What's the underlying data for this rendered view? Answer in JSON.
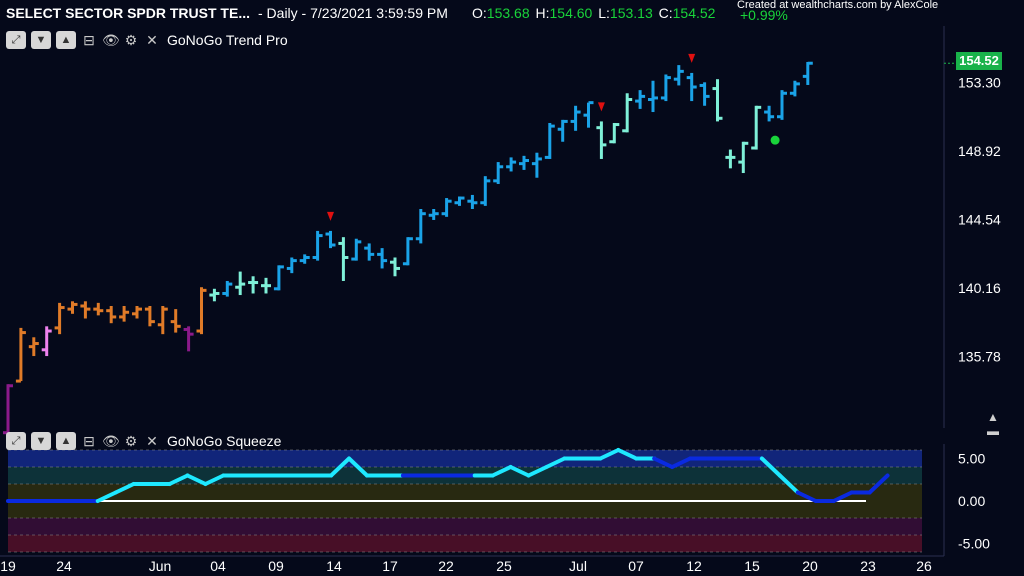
{
  "header": {
    "symbol": "SELECT SECTOR SPDR TRUST TE...",
    "meta": "- Daily - 7/23/2021 3:59:59 PM",
    "ohlc": [
      {
        "k": "O:",
        "v": "153.68"
      },
      {
        "k": "H:",
        "v": "154.60"
      },
      {
        "k": "L:",
        "v": "153.13"
      },
      {
        "k": "C:",
        "v": "154.52"
      }
    ],
    "change": "+0.99%",
    "credit": "Created at wealthcharts.com by AlexCole"
  },
  "top_panel": {
    "title": "GoNoGo Trend Pro",
    "last_price": "154.52"
  },
  "bottom_panel": {
    "title": "GoNoGo Squeeze"
  },
  "icons": [
    "expand-icon",
    "chevron-down-icon",
    "chevron-up-icon",
    "collapse-icon",
    "eye-icon",
    "gear-icon",
    "close-icon"
  ],
  "colors": {
    "background": "#05091a",
    "go_strong": "#1aa3e8",
    "go_weak": "#7ff0d8",
    "nogo_strong": "#8b1a8a",
    "nogo_weak": "#e07b28",
    "amber": "#e07b28",
    "pink": "#ee82ee",
    "marker_red": "#e01010",
    "marker_green": "#19d43a",
    "squeeze_cyan": "#1ee8ff",
    "squeeze_blue": "#0a2ae0",
    "positive": "#19d43a"
  },
  "chart_data": [
    {
      "type": "ohlc",
      "name": "GoNoGo Trend Pro",
      "x_tick_labels": [
        "19",
        "24",
        "Jun",
        "04",
        "09",
        "14",
        "17",
        "22",
        "25",
        "Jul",
        "07",
        "12",
        "15",
        "20",
        "23",
        "26"
      ],
      "y_tick_labels": [
        "153.30",
        "148.92",
        "144.54",
        "140.16",
        "135.78"
      ],
      "ylim": [
        131.2,
        156.9
      ],
      "color_key": {
        "G": "go_strong",
        "g": "go_weak",
        "a": "amber",
        "p": "pink",
        "m": "nogo_strong"
      },
      "bars": [
        {
          "o": 130.9,
          "h": 134.0,
          "l": 130.4,
          "c": 133.9,
          "color": "m"
        },
        {
          "o": 134.2,
          "h": 137.6,
          "l": 134.2,
          "c": 137.3,
          "color": "a"
        },
        {
          "o": 136.4,
          "h": 137.0,
          "l": 135.8,
          "c": 136.6,
          "color": "a"
        },
        {
          "o": 136.2,
          "h": 137.7,
          "l": 135.8,
          "c": 137.4,
          "color": "p"
        },
        {
          "o": 137.6,
          "h": 139.2,
          "l": 137.2,
          "c": 138.9,
          "color": "a"
        },
        {
          "o": 138.8,
          "h": 139.3,
          "l": 138.5,
          "c": 139.1,
          "color": "a"
        },
        {
          "o": 139.0,
          "h": 139.3,
          "l": 138.2,
          "c": 138.8,
          "color": "a"
        },
        {
          "o": 138.8,
          "h": 139.2,
          "l": 138.4,
          "c": 138.7,
          "color": "a"
        },
        {
          "o": 138.7,
          "h": 139.0,
          "l": 137.9,
          "c": 138.3,
          "color": "a"
        },
        {
          "o": 138.3,
          "h": 139.0,
          "l": 138.0,
          "c": 138.6,
          "color": "a"
        },
        {
          "o": 138.5,
          "h": 139.0,
          "l": 138.2,
          "c": 138.8,
          "color": "a"
        },
        {
          "o": 138.8,
          "h": 139.0,
          "l": 137.7,
          "c": 138.0,
          "color": "a"
        },
        {
          "o": 137.8,
          "h": 139.0,
          "l": 137.2,
          "c": 138.8,
          "color": "a"
        },
        {
          "o": 138.0,
          "h": 138.8,
          "l": 137.3,
          "c": 137.7,
          "color": "a"
        },
        {
          "o": 137.5,
          "h": 137.7,
          "l": 136.1,
          "c": 137.2,
          "color": "m"
        },
        {
          "o": 137.4,
          "h": 140.2,
          "l": 137.2,
          "c": 140.0,
          "color": "a"
        },
        {
          "o": 139.7,
          "h": 140.1,
          "l": 139.3,
          "c": 139.8,
          "color": "g"
        },
        {
          "o": 139.8,
          "h": 140.6,
          "l": 139.6,
          "c": 140.4,
          "color": "G"
        },
        {
          "o": 140.2,
          "h": 141.2,
          "l": 139.7,
          "c": 140.4,
          "color": "g"
        },
        {
          "o": 140.5,
          "h": 140.9,
          "l": 139.8,
          "c": 140.5,
          "color": "g"
        },
        {
          "o": 140.3,
          "h": 140.8,
          "l": 139.8,
          "c": 140.3,
          "color": "g"
        },
        {
          "o": 140.1,
          "h": 141.6,
          "l": 140.0,
          "c": 141.5,
          "color": "G"
        },
        {
          "o": 141.4,
          "h": 142.1,
          "l": 141.1,
          "c": 141.9,
          "color": "G"
        },
        {
          "o": 141.9,
          "h": 142.3,
          "l": 141.7,
          "c": 142.1,
          "color": "G"
        },
        {
          "o": 142.1,
          "h": 143.8,
          "l": 141.9,
          "c": 143.5,
          "color": "G"
        },
        {
          "o": 143.6,
          "h": 143.8,
          "l": 142.7,
          "c": 142.9,
          "color": "G"
        },
        {
          "o": 143.0,
          "h": 143.4,
          "l": 140.6,
          "c": 142.1,
          "color": "g"
        },
        {
          "o": 142.0,
          "h": 143.3,
          "l": 141.9,
          "c": 143.1,
          "color": "G"
        },
        {
          "o": 142.7,
          "h": 143.0,
          "l": 141.9,
          "c": 142.3,
          "color": "G"
        },
        {
          "o": 142.3,
          "h": 142.7,
          "l": 141.4,
          "c": 141.9,
          "color": "G"
        },
        {
          "o": 141.8,
          "h": 142.1,
          "l": 140.9,
          "c": 141.4,
          "color": "g"
        },
        {
          "o": 141.7,
          "h": 143.4,
          "l": 141.6,
          "c": 143.3,
          "color": "G"
        },
        {
          "o": 143.3,
          "h": 145.2,
          "l": 143.0,
          "c": 144.9,
          "color": "G"
        },
        {
          "o": 144.8,
          "h": 145.2,
          "l": 144.5,
          "c": 144.9,
          "color": "G"
        },
        {
          "o": 144.9,
          "h": 145.9,
          "l": 144.7,
          "c": 145.7,
          "color": "G"
        },
        {
          "o": 145.6,
          "h": 146.0,
          "l": 145.4,
          "c": 145.9,
          "color": "G"
        },
        {
          "o": 145.7,
          "h": 146.1,
          "l": 145.2,
          "c": 145.6,
          "color": "G"
        },
        {
          "o": 145.6,
          "h": 147.3,
          "l": 145.4,
          "c": 147.0,
          "color": "G"
        },
        {
          "o": 147.0,
          "h": 148.2,
          "l": 146.8,
          "c": 147.9,
          "color": "G"
        },
        {
          "o": 147.9,
          "h": 148.5,
          "l": 147.6,
          "c": 148.2,
          "color": "G"
        },
        {
          "o": 148.1,
          "h": 148.6,
          "l": 147.7,
          "c": 148.3,
          "color": "G"
        },
        {
          "o": 148.1,
          "h": 148.8,
          "l": 147.2,
          "c": 148.4,
          "color": "G"
        },
        {
          "o": 148.5,
          "h": 150.7,
          "l": 148.4,
          "c": 150.5,
          "color": "G"
        },
        {
          "o": 150.3,
          "h": 150.9,
          "l": 149.5,
          "c": 150.8,
          "color": "G"
        },
        {
          "o": 150.8,
          "h": 151.8,
          "l": 150.2,
          "c": 151.4,
          "color": "G"
        },
        {
          "o": 151.2,
          "h": 152.0,
          "l": 150.4,
          "c": 152.0,
          "color": "G"
        },
        {
          "o": 150.4,
          "h": 150.8,
          "l": 148.4,
          "c": 149.3,
          "color": "g"
        },
        {
          "o": 149.5,
          "h": 150.7,
          "l": 149.4,
          "c": 150.6,
          "color": "g"
        },
        {
          "o": 150.2,
          "h": 152.6,
          "l": 150.1,
          "c": 152.2,
          "color": "g"
        },
        {
          "o": 152.1,
          "h": 152.8,
          "l": 151.6,
          "c": 152.4,
          "color": "G"
        },
        {
          "o": 152.2,
          "h": 153.4,
          "l": 151.4,
          "c": 152.3,
          "color": "G"
        },
        {
          "o": 152.3,
          "h": 153.8,
          "l": 152.1,
          "c": 153.6,
          "color": "G"
        },
        {
          "o": 153.5,
          "h": 154.4,
          "l": 153.1,
          "c": 154.0,
          "color": "G"
        },
        {
          "o": 153.6,
          "h": 153.9,
          "l": 152.1,
          "c": 153.0,
          "color": "G"
        },
        {
          "o": 153.1,
          "h": 153.3,
          "l": 151.8,
          "c": 152.4,
          "color": "G"
        },
        {
          "o": 152.9,
          "h": 153.5,
          "l": 150.8,
          "c": 151.0,
          "color": "g"
        },
        {
          "o": 148.5,
          "h": 149.0,
          "l": 147.8,
          "c": 148.5,
          "color": "g"
        },
        {
          "o": 148.2,
          "h": 149.5,
          "l": 147.5,
          "c": 149.4,
          "color": "g"
        },
        {
          "o": 149.1,
          "h": 151.8,
          "l": 149.0,
          "c": 151.7,
          "color": "g"
        },
        {
          "o": 151.4,
          "h": 151.8,
          "l": 150.8,
          "c": 151.1,
          "color": "G"
        },
        {
          "o": 151.1,
          "h": 152.8,
          "l": 150.9,
          "c": 152.6,
          "color": "G"
        },
        {
          "o": 152.6,
          "h": 153.4,
          "l": 152.4,
          "c": 153.2,
          "color": "G"
        },
        {
          "o": 153.68,
          "h": 154.6,
          "l": 153.13,
          "c": 154.52,
          "color": "G"
        }
      ],
      "markers": [
        {
          "type": "triangle-down",
          "bar": 25,
          "color": "marker_red"
        },
        {
          "type": "triangle-down",
          "bar": 46,
          "color": "marker_red"
        },
        {
          "type": "triangle-down",
          "bar": 53,
          "color": "marker_red"
        },
        {
          "type": "circle",
          "bar": 59,
          "color": "marker_green",
          "y": 149.6
        }
      ]
    },
    {
      "type": "line",
      "name": "GoNoGo Squeeze",
      "y_tick_labels": [
        "5.00",
        "0.00",
        "-5.00"
      ],
      "ylim": [
        -6,
        6
      ],
      "values": [
        0,
        0,
        0,
        0,
        0,
        0,
        1,
        2,
        2,
        2,
        3,
        2,
        3,
        3,
        3,
        3,
        3,
        3,
        3,
        5,
        3,
        3,
        3,
        3,
        3,
        3,
        3,
        3,
        4,
        3,
        4,
        5,
        5,
        5,
        6,
        5,
        5,
        4,
        5,
        5,
        5,
        5,
        5,
        3,
        1,
        0,
        0,
        1,
        1,
        3
      ],
      "segment_colors": [
        "blue",
        "blue",
        "blue",
        "blue",
        "blue",
        "cyan",
        "cyan",
        "cyan",
        "cyan",
        "cyan",
        "cyan",
        "cyan",
        "cyan",
        "cyan",
        "cyan",
        "cyan",
        "cyan",
        "cyan",
        "cyan",
        "cyan",
        "cyan",
        "cyan",
        "blue",
        "blue",
        "blue",
        "blue",
        "cyan",
        "cyan",
        "cyan",
        "cyan",
        "cyan",
        "cyan",
        "cyan",
        "cyan",
        "cyan",
        "cyan",
        "blue",
        "blue",
        "blue",
        "blue",
        "blue",
        "blue",
        "cyan",
        "cyan",
        "blue",
        "blue",
        "blue",
        "blue",
        "blue"
      ]
    }
  ]
}
